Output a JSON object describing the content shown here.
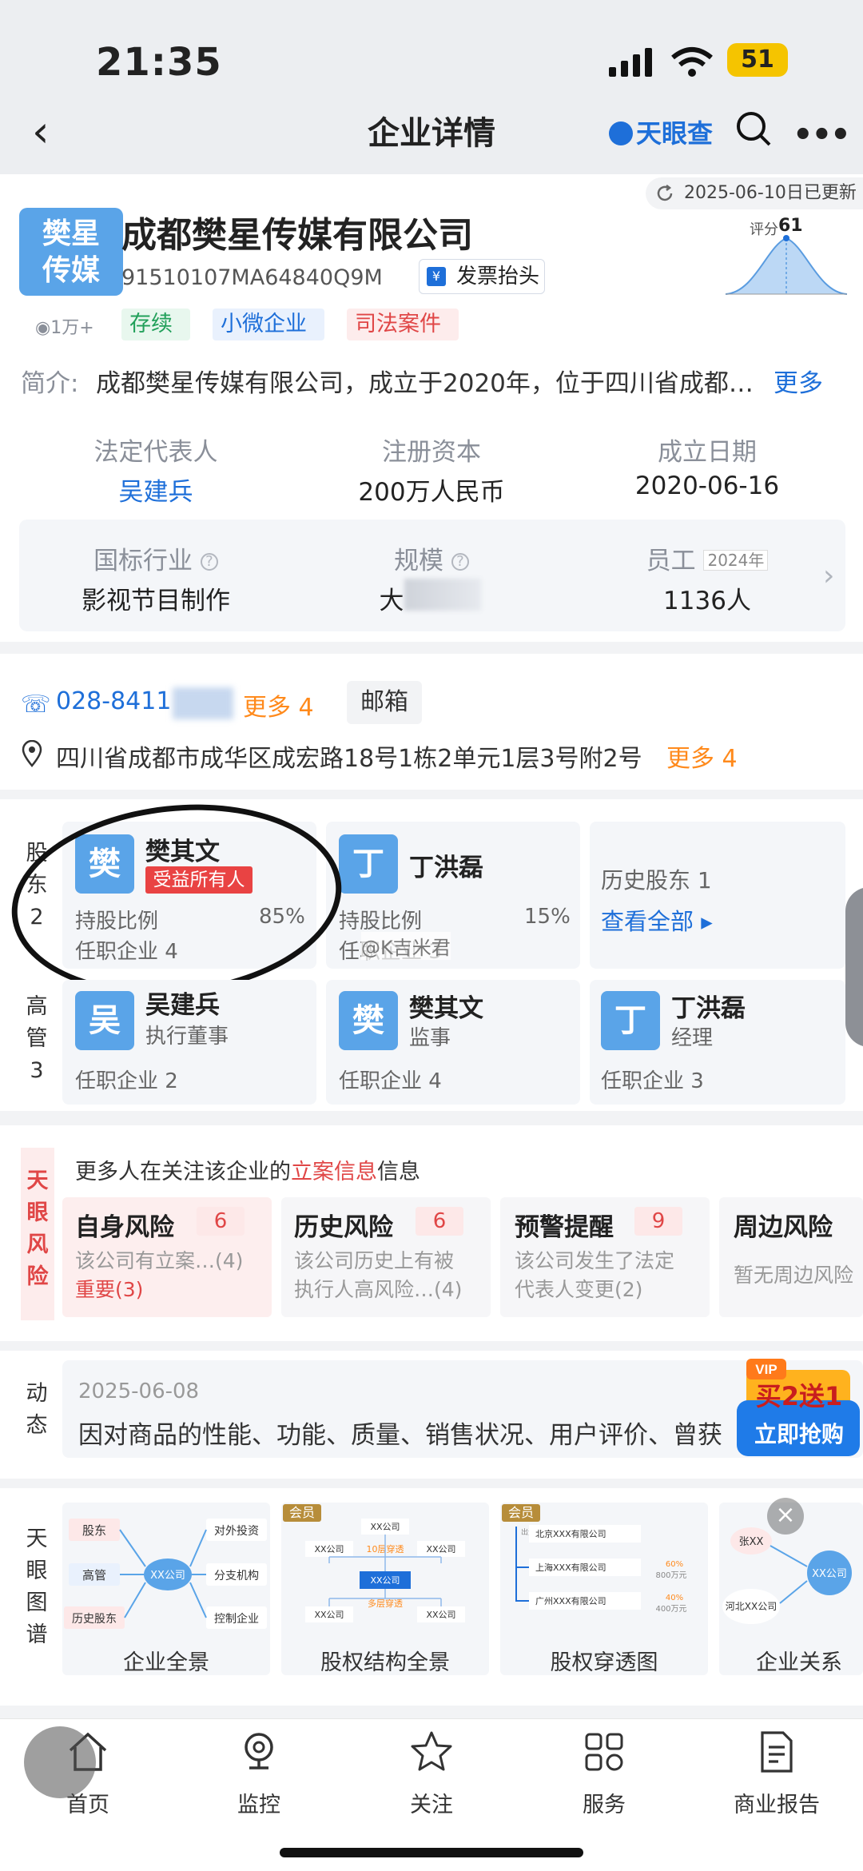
{
  "status_bar": {
    "time": "21:35",
    "battery": "51"
  },
  "nav": {
    "title": "企业详情",
    "brand": "天眼查"
  },
  "header": {
    "update_text": "2025-06-10日已更新",
    "logo_line1": "樊星",
    "logo_line2": "传媒",
    "company_name": "成都樊星传媒有限公司",
    "credit_code": "91510107MA64840Q9M",
    "invoice_label": "发票抬头",
    "views": "1万+",
    "tags": [
      "存续",
      "小微企业",
      "司法案件"
    ],
    "score_label": "评分",
    "score": "61",
    "intro_label": "简介:",
    "intro_text": "成都樊星传媒有限公司，成立于2020年，位于四川省成都…",
    "intro_more": "更多"
  },
  "info": {
    "legal_rep_label": "法定代表人",
    "legal_rep": "吴建兵",
    "capital_label": "注册资本",
    "capital": "200万人民币",
    "founded_label": "成立日期",
    "founded": "2020-06-16",
    "industry_label": "国标行业",
    "industry": "影视节目制作",
    "scale_label": "规模",
    "scale": "大",
    "staff_label": "员工",
    "staff_year": "2024年",
    "staff": "1136人"
  },
  "contact": {
    "phone": "028-8411",
    "phone_more": "更多 4",
    "email_label": "邮箱",
    "address": "四川省成都市成华区成宏路18号1栋2单元1层3号附2号",
    "address_more": "更多 4"
  },
  "shareholders": {
    "side_label": [
      "股",
      "东",
      "2"
    ],
    "items": [
      {
        "avatar": "樊",
        "name": "樊其文",
        "badge": "受益所有人",
        "ratio_label": "持股比例",
        "ratio": "85%",
        "jobs": "任职企业 4"
      },
      {
        "avatar": "丁",
        "name": "丁洪磊",
        "ratio_label": "持股比例",
        "ratio": "15%",
        "jobs": "任职企业 3"
      }
    ],
    "history_label": "历史股东 1",
    "history_link": "查看全部 ▸"
  },
  "watermark": "@K吉米君",
  "executives": {
    "side_label": [
      "高",
      "管",
      "3"
    ],
    "items": [
      {
        "avatar": "吴",
        "name": "吴建兵",
        "role": "执行董事",
        "jobs": "任职企业 2"
      },
      {
        "avatar": "樊",
        "name": "樊其文",
        "role": "监事",
        "jobs": "任职企业 4"
      },
      {
        "avatar": "丁",
        "name": "丁洪磊",
        "role": "经理",
        "jobs": "任职企业 3"
      }
    ]
  },
  "risk": {
    "side_label": [
      "天",
      "眼",
      "风",
      "险"
    ],
    "notice_prefix": "更多人在关注该企业的",
    "notice_highlight": "立案信息",
    "notice_suffix": "信息",
    "items": [
      {
        "title": "自身风险",
        "count": "6",
        "desc1": "该公司有立案…(4)",
        "desc2": "重要(3)"
      },
      {
        "title": "历史风险",
        "count": "6",
        "desc1": "该公司历史上有被",
        "desc2": "执行人高风险…(4)"
      },
      {
        "title": "预警提醒",
        "count": "9",
        "desc1": "该公司发生了法定",
        "desc2": "代表人变更(2)"
      },
      {
        "title": "周边风险",
        "desc1": "暂无周边风险"
      }
    ]
  },
  "dynamic": {
    "side_label": [
      "动",
      "态"
    ],
    "date": "2025-06-08",
    "text": "因对商品的性能、功能、质量、销售状况、用户评价、曾获",
    "vip_badge": "VIP",
    "vip_line1": "买2送1",
    "vip_line2": "立即抢购"
  },
  "graph": {
    "side_label": [
      "天",
      "眼",
      "图",
      "谱"
    ],
    "member_label": "会员",
    "items": [
      {
        "label": "企业全景",
        "nodes": [
          "股东",
          "高管",
          "历史股东",
          "XX公司",
          "对外投资",
          "分支机构",
          "控制企业"
        ]
      },
      {
        "label": "股权结构全景",
        "nodes": [
          "XX公司",
          "XX公司",
          "10层穿透",
          "XX公司",
          "XX公司",
          "XX公司",
          "多层穿透",
          "XX公司"
        ]
      },
      {
        "label": "股权穿透图",
        "nodes": [
          "出资",
          "北京XXX有限公司",
          "上海XXX有限公司",
          "60%",
          "800万元",
          "广州XXX有限公司",
          "40%",
          "400万元"
        ]
      },
      {
        "label": "企业关系",
        "nodes": [
          "张XX",
          "XX公司",
          "河北XX公司"
        ]
      }
    ]
  },
  "tabs": [
    "首页",
    "监控",
    "关注",
    "服务",
    "商业报告"
  ],
  "colors": {
    "accent": "#1e6fd9",
    "orange": "#ff8a1c",
    "red": "#e04646",
    "green": "#22a05a"
  }
}
